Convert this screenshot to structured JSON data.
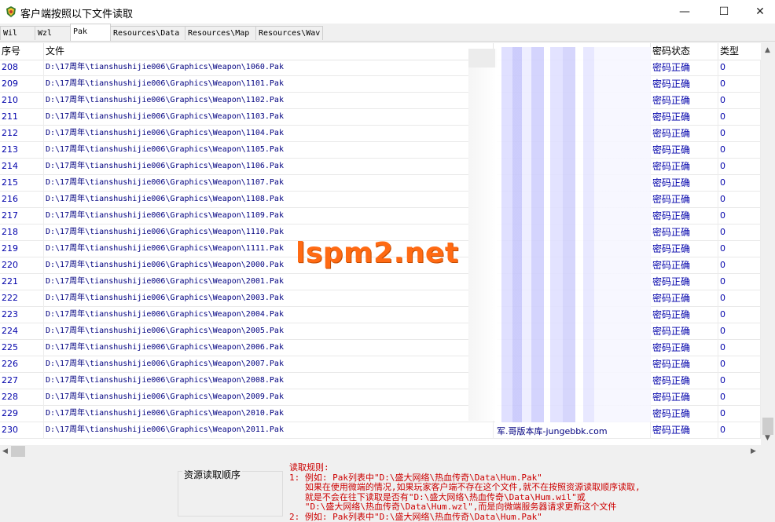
{
  "window": {
    "title": "客户端按照以下文件读取",
    "minimize": "—",
    "maximize": "☐",
    "close": "✕"
  },
  "tabs": [
    {
      "label": "Wil"
    },
    {
      "label": "Wzl"
    },
    {
      "label": "Pak"
    },
    {
      "label": "Resources\\Data"
    },
    {
      "label": "Resources\\Map"
    },
    {
      "label": "Resources\\Wav"
    }
  ],
  "table": {
    "headers": {
      "index": "序号",
      "file": "文件",
      "status": "密码状态",
      "type": "类型"
    },
    "rows": [
      {
        "index": "208",
        "file": "D:\\17周年\\tianshushijie006\\Graphics\\Weapon\\1060.Pak",
        "status": "密码正确",
        "type": "0"
      },
      {
        "index": "209",
        "file": "D:\\17周年\\tianshushijie006\\Graphics\\Weapon\\1101.Pak",
        "status": "密码正确",
        "type": "0"
      },
      {
        "index": "210",
        "file": "D:\\17周年\\tianshushijie006\\Graphics\\Weapon\\1102.Pak",
        "status": "密码正确",
        "type": "0"
      },
      {
        "index": "211",
        "file": "D:\\17周年\\tianshushijie006\\Graphics\\Weapon\\1103.Pak",
        "status": "密码正确",
        "type": "0"
      },
      {
        "index": "212",
        "file": "D:\\17周年\\tianshushijie006\\Graphics\\Weapon\\1104.Pak",
        "status": "密码正确",
        "type": "0"
      },
      {
        "index": "213",
        "file": "D:\\17周年\\tianshushijie006\\Graphics\\Weapon\\1105.Pak",
        "status": "密码正确",
        "type": "0"
      },
      {
        "index": "214",
        "file": "D:\\17周年\\tianshushijie006\\Graphics\\Weapon\\1106.Pak",
        "status": "密码正确",
        "type": "0"
      },
      {
        "index": "215",
        "file": "D:\\17周年\\tianshushijie006\\Graphics\\Weapon\\1107.Pak",
        "status": "密码正确",
        "type": "0"
      },
      {
        "index": "216",
        "file": "D:\\17周年\\tianshushijie006\\Graphics\\Weapon\\1108.Pak",
        "status": "密码正确",
        "type": "0"
      },
      {
        "index": "217",
        "file": "D:\\17周年\\tianshushijie006\\Graphics\\Weapon\\1109.Pak",
        "status": "密码正确",
        "type": "0"
      },
      {
        "index": "218",
        "file": "D:\\17周年\\tianshushijie006\\Graphics\\Weapon\\1110.Pak",
        "status": "密码正确",
        "type": "0"
      },
      {
        "index": "219",
        "file": "D:\\17周年\\tianshushijie006\\Graphics\\Weapon\\1111.Pak",
        "status": "密码正确",
        "type": "0"
      },
      {
        "index": "220",
        "file": "D:\\17周年\\tianshushijie006\\Graphics\\Weapon\\2000.Pak",
        "status": "密码正确",
        "type": "0"
      },
      {
        "index": "221",
        "file": "D:\\17周年\\tianshushijie006\\Graphics\\Weapon\\2001.Pak",
        "status": "密码正确",
        "type": "0"
      },
      {
        "index": "222",
        "file": "D:\\17周年\\tianshushijie006\\Graphics\\Weapon\\2003.Pak",
        "status": "密码正确",
        "type": "0"
      },
      {
        "index": "223",
        "file": "D:\\17周年\\tianshushijie006\\Graphics\\Weapon\\2004.Pak",
        "status": "密码正确",
        "type": "0"
      },
      {
        "index": "224",
        "file": "D:\\17周年\\tianshushijie006\\Graphics\\Weapon\\2005.Pak",
        "status": "密码正确",
        "type": "0"
      },
      {
        "index": "225",
        "file": "D:\\17周年\\tianshushijie006\\Graphics\\Weapon\\2006.Pak",
        "status": "密码正确",
        "type": "0"
      },
      {
        "index": "226",
        "file": "D:\\17周年\\tianshushijie006\\Graphics\\Weapon\\2007.Pak",
        "status": "密码正确",
        "type": "0"
      },
      {
        "index": "227",
        "file": "D:\\17周年\\tianshushijie006\\Graphics\\Weapon\\2008.Pak",
        "status": "密码正确",
        "type": "0"
      },
      {
        "index": "228",
        "file": "D:\\17周年\\tianshushijie006\\Graphics\\Weapon\\2009.Pak",
        "status": "密码正确",
        "type": "0"
      },
      {
        "index": "229",
        "file": "D:\\17周年\\tianshushijie006\\Graphics\\Weapon\\2010.Pak",
        "status": "密码正确",
        "type": "0"
      },
      {
        "index": "230",
        "file": "D:\\17周年\\tianshushijie006\\Graphics\\Weapon\\2011.Pak",
        "status": "密码正确",
        "type": "0"
      }
    ],
    "last_row_password_visible": "军.哥版本库-jungebbk.com"
  },
  "group_box": {
    "label": "资源读取顺序"
  },
  "rules": {
    "lines": [
      "读取规则:",
      "1: 例如: Pak列表中\"D:\\盛大网络\\热血传奇\\Data\\Hum.Pak\"",
      "   如果在使用微端的情况,如果玩家客户端不存在这个文件,就不在按照资源读取顺序读取,",
      "   就是不会在往下读取是否有\"D:\\盛大网络\\热血传奇\\Data\\Hum.wil\"或",
      "   \"D:\\盛大网络\\热血传奇\\Data\\Hum.wzl\",而是向微端服务器请求更新这个文件",
      "2: 例如: Pak列表中\"D:\\盛大网络\\热血传奇\\Data\\Hum.Pak\""
    ]
  },
  "watermark": {
    "text": "lspm2.net"
  },
  "colors": {
    "row_text": "#0000aa",
    "rules_text": "#cc0000",
    "watermark": "#ff6a13"
  }
}
